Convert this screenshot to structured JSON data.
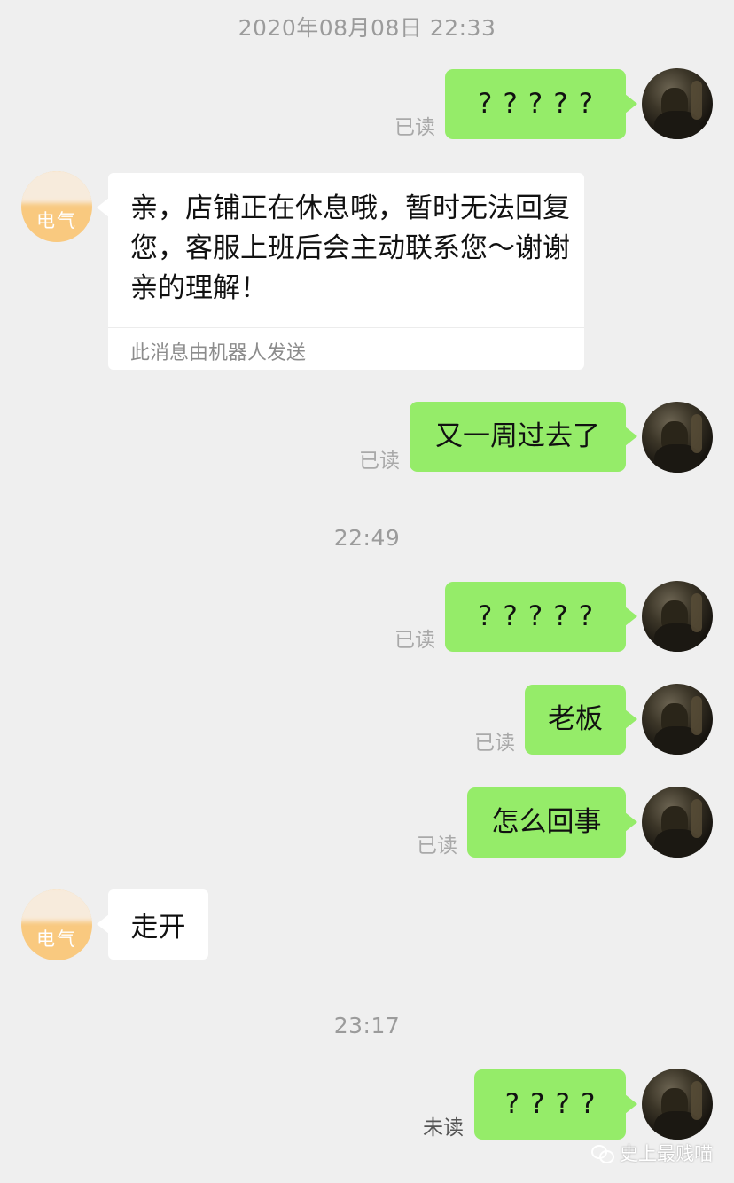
{
  "timestamps": {
    "t1": "2020年08月08日 22:33",
    "t2": "22:49",
    "t3": "23:17"
  },
  "shop": {
    "avatar_label": "电气"
  },
  "messages": {
    "m1": {
      "text": "?????",
      "status": "已读"
    },
    "auto_reply": {
      "text": "亲，店铺正在休息哦，暂时无法回复您，客服上班后会主动联系您～谢谢亲的理解！",
      "footer": "此消息由机器人发送"
    },
    "m2": {
      "text": "又一周过去了",
      "status": "已读"
    },
    "m3": {
      "text": "?????",
      "status": "已读"
    },
    "m4": {
      "text": "老板",
      "status": "已读"
    },
    "m5": {
      "text": "怎么回事",
      "status": "已读"
    },
    "shop_reply": {
      "text": "走开"
    },
    "m6": {
      "text": "????",
      "status": "未读"
    }
  },
  "watermark": {
    "text": "史上最贱喵",
    "icon": "wechat-icon"
  },
  "colors": {
    "background": "#efefef",
    "sent_bubble": "#95ec69",
    "received_bubble": "#ffffff",
    "shop_avatar": "#f9c97f",
    "timestamp": "#9b9b9b"
  }
}
